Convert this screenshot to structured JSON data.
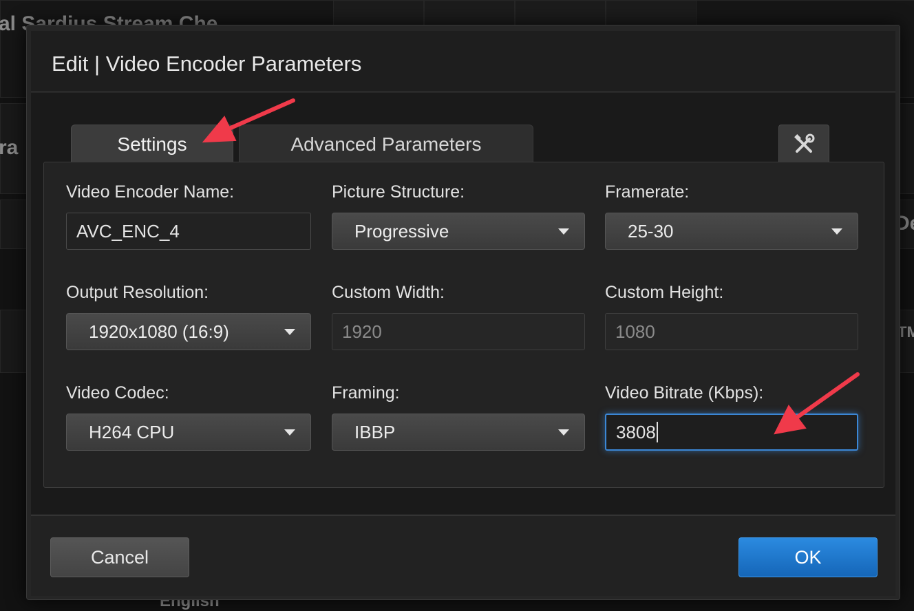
{
  "background": {
    "title_fragment": "al Sardius Stream Che",
    "left_fragment": "ra",
    "right_fragment_1": "De",
    "right_fragment_2": "TM",
    "bottom_fragment": "English"
  },
  "dialog": {
    "title": "Edit | Video Encoder Parameters",
    "tabs": [
      {
        "label": "Settings",
        "active": true
      },
      {
        "label": "Advanced Parameters",
        "active": false
      }
    ],
    "tools_icon": "wrench-screwdriver-icon",
    "fields": {
      "encoder_name": {
        "label": "Video Encoder Name:",
        "value": "AVC_ENC_4"
      },
      "picture_structure": {
        "label": "Picture Structure:",
        "value": "Progressive"
      },
      "framerate": {
        "label": "Framerate:",
        "value": "25-30"
      },
      "output_resolution": {
        "label": "Output Resolution:",
        "value": "1920x1080 (16:9)"
      },
      "custom_width": {
        "label": "Custom Width:",
        "value": "1920"
      },
      "custom_height": {
        "label": "Custom Height:",
        "value": "1080"
      },
      "video_codec": {
        "label": "Video Codec:",
        "value": "H264 CPU"
      },
      "framing": {
        "label": "Framing:",
        "value": "IBBP"
      },
      "video_bitrate": {
        "label": "Video Bitrate (Kbps):",
        "value": "3808"
      }
    },
    "buttons": {
      "cancel": "Cancel",
      "ok": "OK"
    }
  },
  "colors": {
    "accent": "#2b8ae0",
    "annotation_arrow": "#f03a4a",
    "focus_border": "#3b87d6"
  }
}
